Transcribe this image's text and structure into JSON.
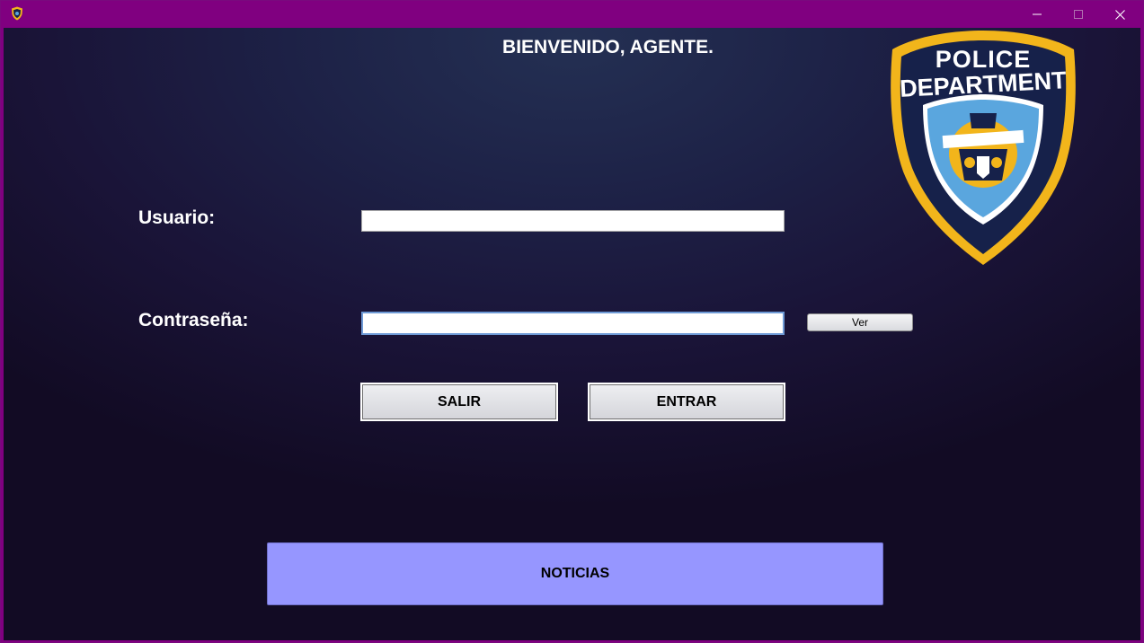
{
  "window": {
    "title": "",
    "controls": {
      "minimize": "minimize-icon",
      "maximize": "maximize-icon",
      "close": "close-icon"
    },
    "titlebar_color": "#800080"
  },
  "header": {
    "title": "BIENVENIDO, AGENTE."
  },
  "form": {
    "user_label": "Usuario:",
    "user_value": "",
    "password_label": "Contraseña:",
    "password_value": "",
    "show_password_label": "Ver"
  },
  "actions": {
    "exit_label": "SALIR",
    "enter_label": "ENTRAR",
    "news_label": "NOTICIAS"
  },
  "logo": {
    "text_line1": "POLICE",
    "text_line2": "DEPARTMENT",
    "gold": "#f2b51b",
    "navy": "#16214a",
    "blue": "#5aa6de"
  },
  "colors": {
    "news_button": "#9696ff",
    "background_top": "#243053",
    "background_bottom": "#120b24"
  }
}
